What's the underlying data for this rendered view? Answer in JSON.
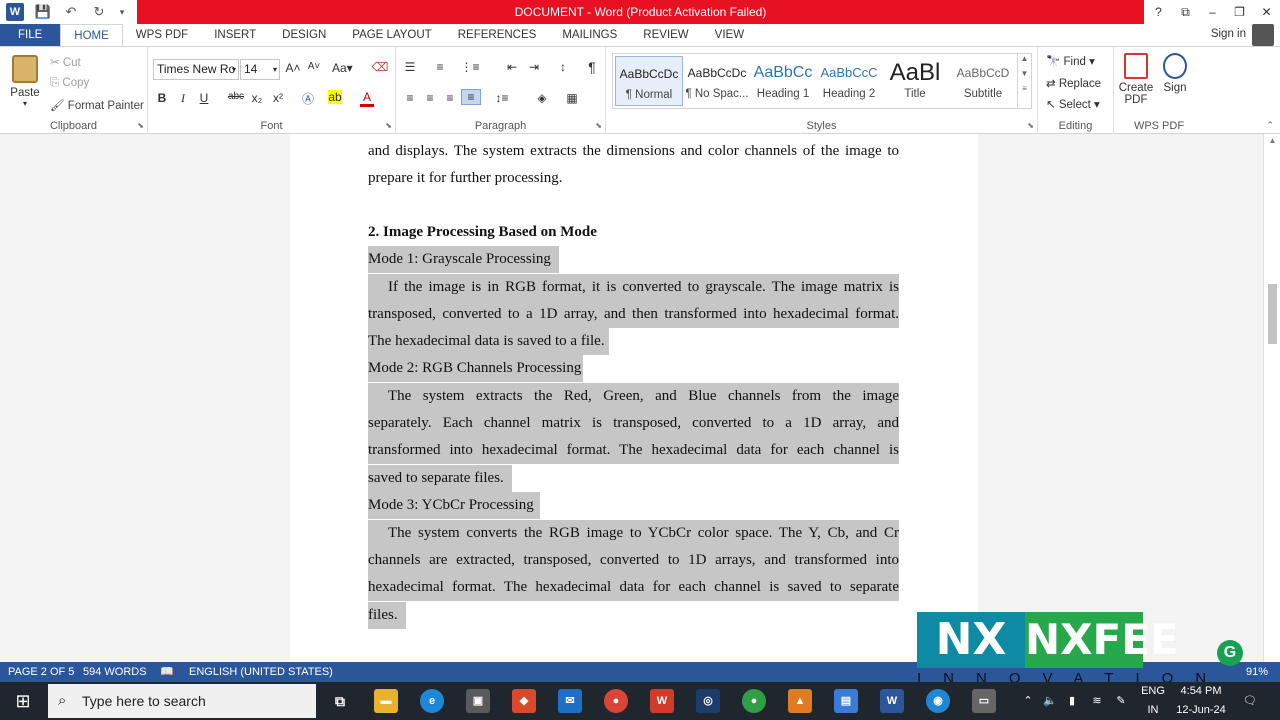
{
  "titlebar": {
    "title": "DOCUMENT - Word (Product Activation Failed)"
  },
  "window_controls": {
    "help": "?",
    "restore_ribbon": "⧉",
    "minimize": "–",
    "maximize": "❐",
    "close": "✕"
  },
  "tabs": [
    "FILE",
    "HOME",
    "WPS PDF",
    "INSERT",
    "DESIGN",
    "PAGE LAYOUT",
    "REFERENCES",
    "MAILINGS",
    "REVIEW",
    "VIEW"
  ],
  "signin": "Sign in",
  "clipboard": {
    "paste": "Paste",
    "cut": "Cut",
    "copy": "Copy",
    "format_painter": "Format Painter",
    "label": "Clipboard"
  },
  "font": {
    "name": "Times New Ro",
    "size": "14",
    "label": "Font",
    "bold": "B",
    "italic": "I",
    "underline": "U",
    "strike": "abc",
    "sub": "x₂",
    "sup": "x²"
  },
  "paragraph": {
    "label": "Paragraph",
    "pilcrow": "¶"
  },
  "styles": {
    "label": "Styles",
    "items": [
      {
        "sample": "AaBbCcDc",
        "name": "¶ Normal"
      },
      {
        "sample": "AaBbCcDc",
        "name": "¶ No Spac..."
      },
      {
        "sample": "AaBbCc",
        "name": "Heading 1"
      },
      {
        "sample": "AaBbCcC",
        "name": "Heading 2"
      },
      {
        "sample": "AaBl",
        "name": "Title"
      },
      {
        "sample": "AaBbCcD",
        "name": "Subtitle"
      }
    ]
  },
  "editing": {
    "find": "Find",
    "replace": "Replace",
    "select": "Select",
    "label": "Editing"
  },
  "wpspdf": {
    "create": "Create PDF",
    "sign": "Sign",
    "label": "WPS PDF"
  },
  "document": {
    "lines": [
      "and displays. The system extracts the dimensions and color channels of the image to",
      "prepare it for further processing.",
      "2. Image Processing Based on Mode",
      "Mode 1: Grayscale Processing",
      "If the image is in RGB format, it is converted to grayscale. The image matrix is",
      "transposed, converted to a 1D array, and then transformed into hexadecimal format.",
      "The hexadecimal data is saved to a file.",
      "Mode 2: RGB Channels Processing",
      "The system extracts the Red, Green, and Blue channels from the image",
      "separately. Each channel matrix is transposed, converted to a 1D array, and",
      "transformed into hexadecimal format. The hexadecimal data for each channel is",
      "saved to separate files.",
      "Mode 3: YCbCr Processing",
      "The system converts the RGB image to YCbCr color space. The Y, Cb, and Cr",
      "channels are extracted, transposed, converted to 1D arrays, and transformed into",
      "hexadecimal format. The hexadecimal data for each channel is saved to separate",
      "files."
    ]
  },
  "statusbar": {
    "page": "PAGE 2 OF 5",
    "words": "594 WORDS",
    "language": "ENGLISH (UNITED STATES)",
    "zoom": "91%"
  },
  "watermark": {
    "mark": "NX",
    "word": "NXFEE",
    "sub": "INNOVATION",
    "badge": "G"
  },
  "taskbar": {
    "search_placeholder": "Type here to search",
    "lang_top": "ENG",
    "lang_bottom": "IN",
    "time": "4:54 PM",
    "date": "12-Jun-24"
  },
  "colors": {
    "brand": "#2b579a",
    "titlebar_alert": "#e81123",
    "selection": "#c6c6c6",
    "taskbar": "#20262e"
  }
}
